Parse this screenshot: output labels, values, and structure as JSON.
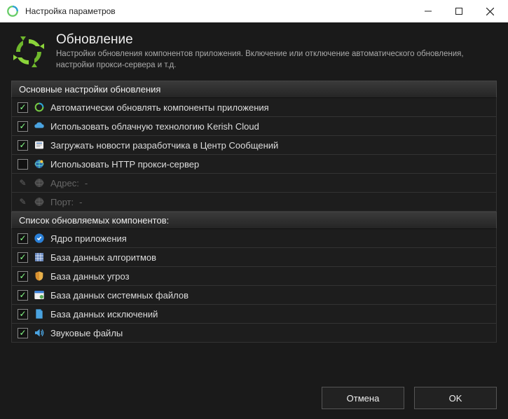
{
  "window": {
    "title": "Настройка параметров"
  },
  "header": {
    "title": "Обновление",
    "subtitle": "Настройки обновления компонентов приложения. Включение или отключение автоматического обновления, настройки прокси-сервера и т.д."
  },
  "section1": {
    "title": "Основные настройки обновления",
    "items": [
      {
        "label": "Автоматически обновлять компоненты приложения",
        "checked": true
      },
      {
        "label": "Использовать облачную технологию Kerish Cloud",
        "checked": true
      },
      {
        "label": "Загружать новости разработчика в Центр Сообщений",
        "checked": true
      },
      {
        "label": "Использовать HTTP прокси-сервер",
        "checked": false
      }
    ],
    "proxy": {
      "address_label": "Адрес:",
      "address_value": "-",
      "port_label": "Порт:",
      "port_value": "-"
    }
  },
  "section2": {
    "title": "Список обновляемых компонентов:",
    "items": [
      {
        "label": "Ядро приложения",
        "checked": true
      },
      {
        "label": "База данных алгоритмов",
        "checked": true
      },
      {
        "label": "База данных угроз",
        "checked": true
      },
      {
        "label": "База данных системных файлов",
        "checked": true
      },
      {
        "label": "База данных исключений",
        "checked": true
      },
      {
        "label": "Звуковые файлы",
        "checked": true
      }
    ]
  },
  "footer": {
    "cancel": "Отмена",
    "ok": "OK"
  }
}
